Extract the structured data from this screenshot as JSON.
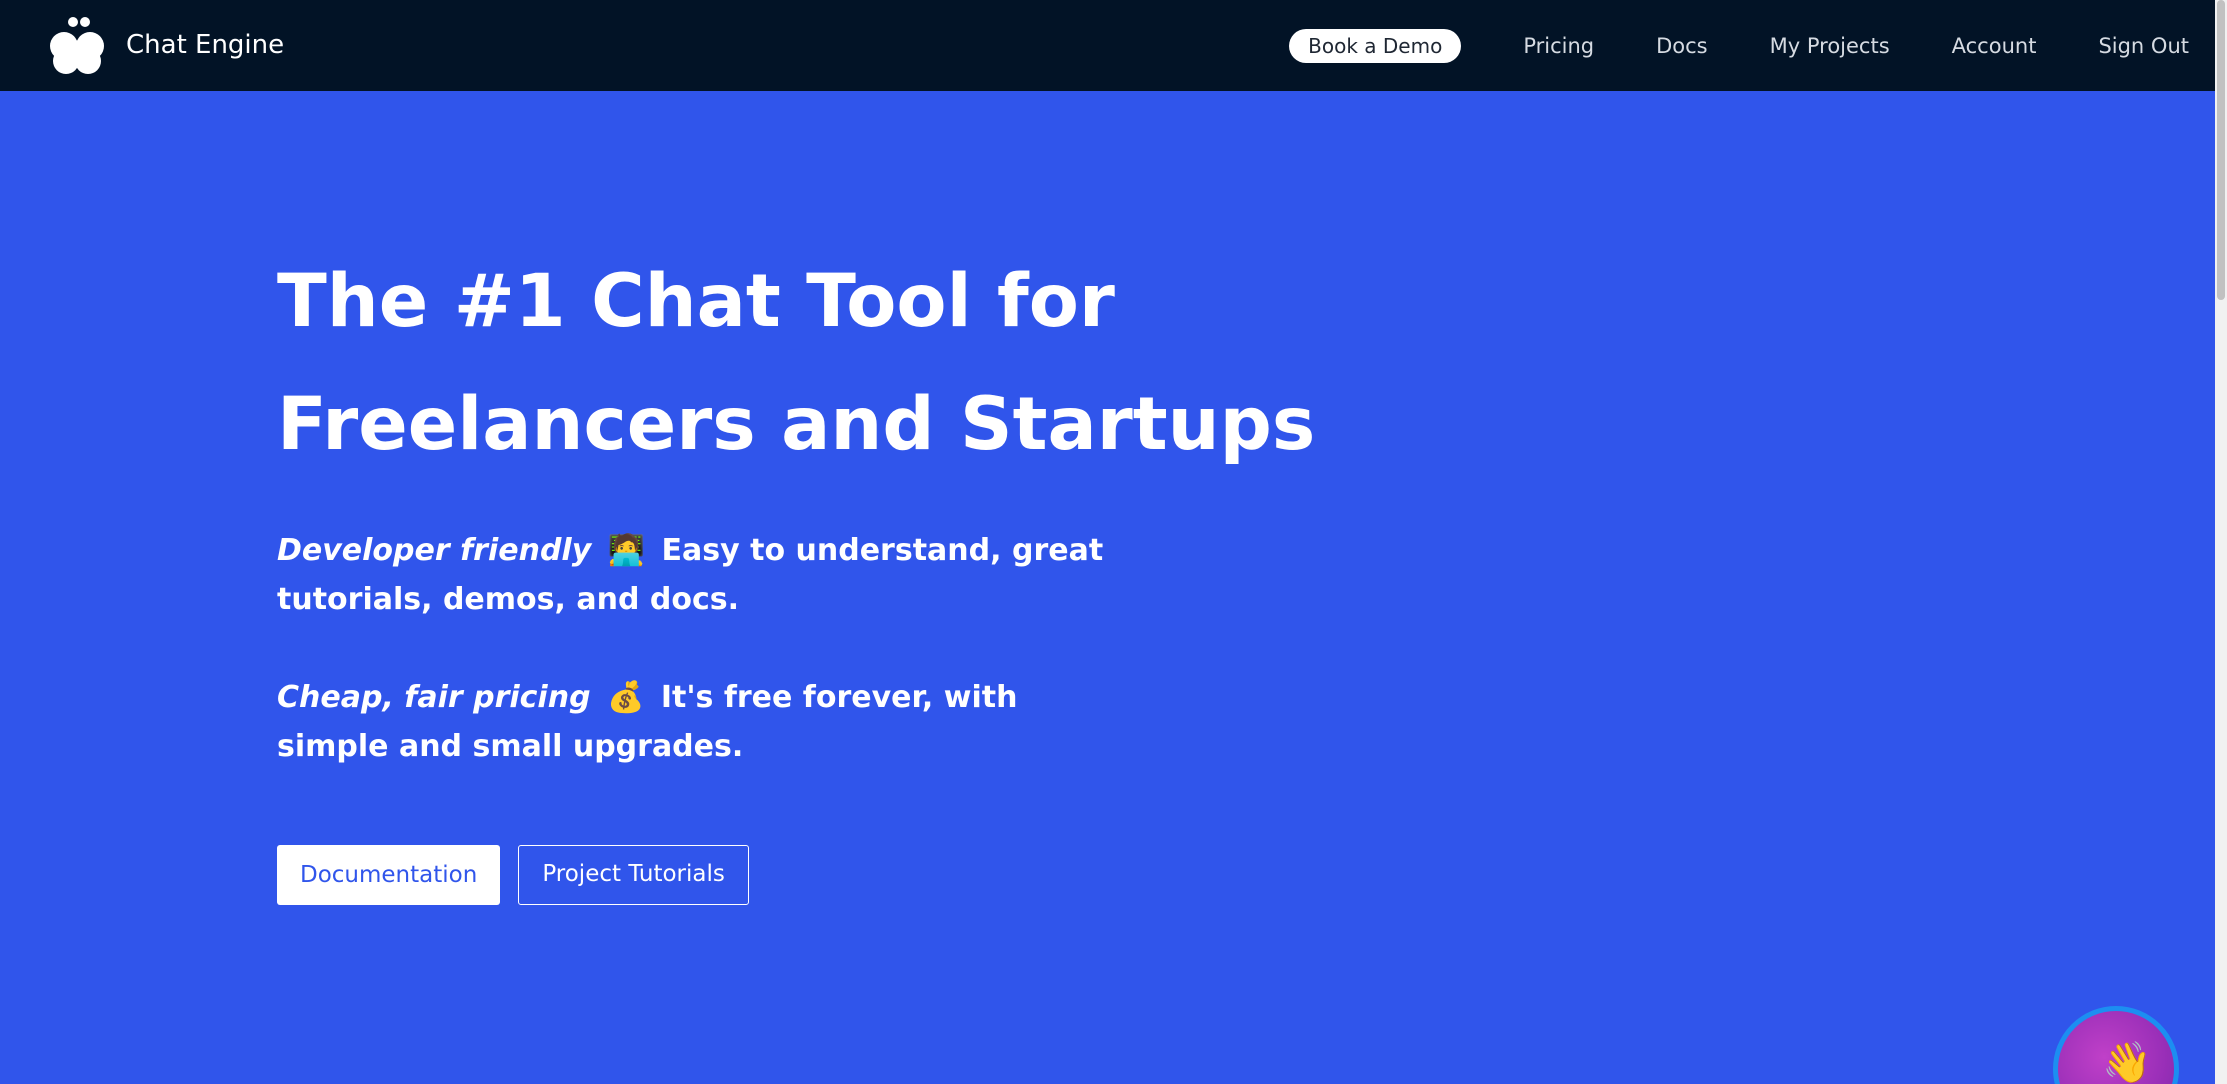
{
  "navbar": {
    "brand_name": "Chat Engine",
    "demo_label": "Book a Demo",
    "links": [
      "Pricing",
      "Docs",
      "My Projects",
      "Account",
      "Sign Out"
    ]
  },
  "hero": {
    "title_line_1": "The #1 Chat Tool for",
    "title_line_2": "Freelancers and Startups",
    "point_1": {
      "emphasis": "Developer friendly",
      "emoji": "🧑‍💻",
      "text": "Easy to understand, great tutorials, demos, and docs."
    },
    "point_2": {
      "emphasis": "Cheap, fair pricing",
      "emoji": "💰",
      "text": "It's free forever, with simple and small upgrades."
    },
    "cta_primary": "Documentation",
    "cta_secondary": "Project Tutorials"
  },
  "chat_widget": {
    "icon": "waving-hand-icon",
    "glyph": "👋"
  },
  "colors": {
    "navbar_bg": "#021326",
    "hero_bg": "#3055EB",
    "accent": "#3055EB",
    "chat_bubble_ring": "#1c8ef1",
    "chat_bubble_fill": "#9a2fb8"
  }
}
